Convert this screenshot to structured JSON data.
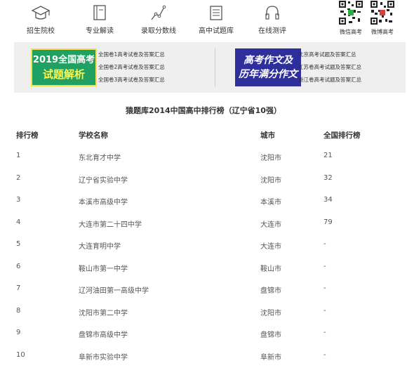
{
  "nav": {
    "items": [
      {
        "label": "招生院校",
        "icon": "graduation-cap-icon"
      },
      {
        "label": "专业解读",
        "icon": "book-icon"
      },
      {
        "label": "录取分数线",
        "icon": "line-chart-icon"
      },
      {
        "label": "高中试题库",
        "icon": "document-stack-icon"
      },
      {
        "label": "在线测评",
        "icon": "headphones-icon"
      }
    ],
    "qr": [
      {
        "label": "微信高考",
        "icon": "wechat-qr-icon"
      },
      {
        "label": "微博高考",
        "icon": "weibo-qr-icon"
      }
    ]
  },
  "banner": {
    "left_promo": {
      "line1": "2019全国高考",
      "line2": "试题解析"
    },
    "left_links": [
      "全国卷1高考试卷及答案汇总",
      "全国卷2高考试卷及答案汇总",
      "全国卷3高考试卷及答案汇总"
    ],
    "right_promo": {
      "line1": "高考作文及",
      "line2": "历年满分作文"
    },
    "right_links": [
      "北京高考试题及答案汇总",
      "江苏卷高考试题及答案汇总",
      "浙江卷高考试题及答案汇总"
    ],
    "colors": {
      "left_bg": "#20a163",
      "left_accent": "#fff44f",
      "right_bg": "#2e2e9c",
      "panel_bg": "#efefef"
    }
  },
  "title": "猿题库2014中国高中排行榜（辽宁省10强）",
  "table": {
    "headers": [
      "排行榜",
      "学校名称",
      "城市",
      "全国排行榜"
    ],
    "rows": [
      [
        "1",
        "东北育才中学",
        "沈阳市",
        "21"
      ],
      [
        "2",
        "辽宁省实验中学",
        "沈阳市",
        "32"
      ],
      [
        "3",
        "本溪市高级中学",
        "本溪市",
        "34"
      ],
      [
        "4",
        "大连市第二十四中学",
        "大连市",
        "79"
      ],
      [
        "5",
        "大连育明中学",
        "大连市",
        "-"
      ],
      [
        "6",
        "鞍山市第一中学",
        "鞍山市",
        "-"
      ],
      [
        "7",
        "辽河油田第一高级中学",
        "盘锦市",
        "-"
      ],
      [
        "8",
        "沈阳市第二中学",
        "沈阳市",
        "-"
      ],
      [
        "9",
        "盘锦市高级中学",
        "盘锦市",
        "-"
      ],
      [
        "10",
        "阜新市实验中学",
        "阜新市",
        "-"
      ]
    ]
  }
}
